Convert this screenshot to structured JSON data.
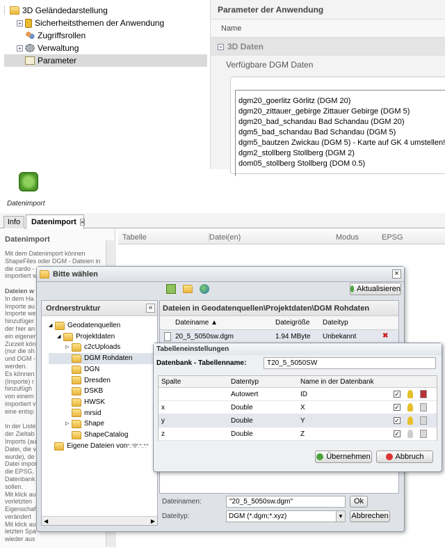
{
  "tree": {
    "root": "3D Geländedarstellung",
    "items": [
      "Sicherheitsthemen der Anwendung",
      "Zugriffsrollen",
      "Verwaltung",
      "Parameter"
    ]
  },
  "params": {
    "title": "Parameter der Anwendung",
    "col_name": "Name",
    "group": "3D Daten",
    "field_label": "Verfügbare DGM Daten",
    "dgm_list": [
      "dgm20_goerlitz Görlitz (DGM 20)",
      "dgm20_zittauer_gebirge Zittauer Gebirge (DGM 5)",
      "dgm20_bad_schandau Bad Schandau (DGM 20)",
      "dgm5_bad_schandau Bad Schandau (DGM 5)",
      "dgm5_bautzen Zwickau (DGM 5) - Karte auf  GK 4 umstellen!",
      "dgm2_stollberg Stollberg (DGM 2)",
      "dom05_stollberg Stollberg (DOM 0.5)"
    ]
  },
  "toolbar": {
    "datenimport": "Datenimport"
  },
  "tabs": {
    "info": "Info",
    "datenimport": "Datenimport",
    "close": "×"
  },
  "main_cols": [
    "Tabelle",
    "Datei(en)",
    "Modus",
    "EPSG"
  ],
  "left_panel": {
    "title": "Datenimport",
    "lines": [
      "Mit dem Datenimport können",
      "ShapeFiles oder DGM - Dateien in",
      "die cardo -",
      "importiert w",
      "",
      "Dateien w",
      "In dem Ha",
      "Importe au",
      "Importe we",
      "hinzufüger",
      "der hier an",
      "ein eigener",
      "Zurzeit kön",
      "(nur die sh",
      "und DGM -",
      "werden.",
      "Es können",
      "(Importe) r",
      "hinzufügh",
      "von einem",
      "importiert v",
      "eine entsp",
      "",
      "In der Liste",
      "der Zieltab",
      "Imports (au",
      "Datei, die v",
      "wurde), de",
      "Datei impor",
      "die EPSG, r",
      "Datenbank",
      "sollen.",
      "Mit klick au",
      "vorletzten",
      "Eigenschaf",
      "verändert",
      "Mit klick au",
      "letzten Spa",
      "wieder aus"
    ]
  },
  "dialog": {
    "title": "Bitte wählen",
    "close": "×",
    "refresh": "Aktualisieren",
    "folder_title": "Ordnerstruktur",
    "collapse": "«",
    "folders": {
      "root": "Geodatenquellen",
      "project": "Projektdaten",
      "items": [
        "c2cUploads",
        "DGM Rohdaten",
        "DGN",
        "Dresden",
        "DSKB",
        "HWSK",
        "mrsid",
        "Shape",
        "ShapeCatalog"
      ],
      "own": "Eigene Dateien von ",
      "own_mask": "*:.*8*.*:.*:*"
    },
    "files_title": "Dateien in Geodatenquellen\\Projektdaten\\DGM Rohdaten",
    "file_cols": [
      "Dateiname ▲",
      "Dateigröße",
      "Dateityp"
    ],
    "file": {
      "name": "20_5_5050sw.dgm",
      "size": "1.94 MByte",
      "type": "Unbekannt",
      "delete": "✖"
    },
    "filename_label": "Dateinamen:",
    "filename_value": "\"20_5_5050sw.dgm\"",
    "ok": "Ok",
    "filetype_label": "Dateityp:",
    "filetype_value": "DGM (*.dgm;*.xyz)",
    "cancel": "Abbrechen"
  },
  "table_dialog": {
    "title": "Tabelleneinstellungen",
    "label": "Datenbank - Tabellenname:",
    "value": "T20_5_5050SW",
    "cols": [
      "Spalte",
      "Datentyp",
      "Name in der Datenbank"
    ],
    "rows": [
      {
        "spalte": "",
        "typ": "Autowert",
        "name": "ID"
      },
      {
        "spalte": "x",
        "typ": "Double",
        "name": "X"
      },
      {
        "spalte": "y",
        "typ": "Double",
        "name": "Y"
      },
      {
        "spalte": "z",
        "typ": "Double",
        "name": "Z"
      }
    ],
    "apply": "Übernehmen",
    "abort": "Abbruch",
    "check": "✓"
  },
  "colors": {
    "accent": "#3d6fa8",
    "selected": "#dadada",
    "bar": "#efefef"
  }
}
